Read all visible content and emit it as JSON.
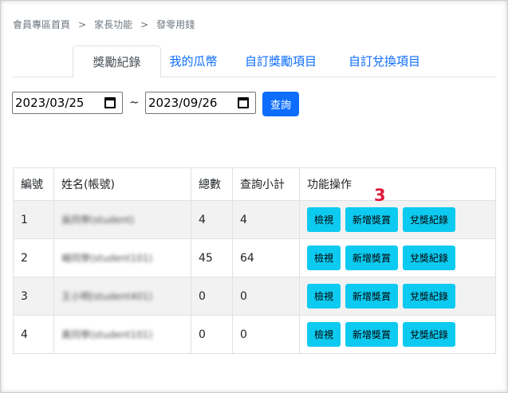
{
  "breadcrumb": [
    "會員專區首頁",
    "家長功能",
    "發零用錢"
  ],
  "breadcrumb_separator": ">",
  "tabs": [
    "獎勵紀錄",
    "我的瓜幣",
    "自訂獎勵項目",
    "自訂兌換項目"
  ],
  "filter": {
    "start_date": "2023/03/25",
    "end_date": "2023/09/26",
    "tilde": "~",
    "query_label": "查詢"
  },
  "table": {
    "headers": [
      "編號",
      "姓名(帳號)",
      "總數",
      "查詢小計",
      "功能操作"
    ],
    "rows": [
      {
        "no": "1",
        "name": "吳同學(student)",
        "total": "4",
        "subtotal": "4"
      },
      {
        "no": "2",
        "name": "楊同學(student101)",
        "total": "45",
        "subtotal": "64"
      },
      {
        "no": "3",
        "name": "王小明(student401)",
        "total": "0",
        "subtotal": "0"
      },
      {
        "no": "4",
        "name": "黃同學(student101)",
        "total": "0",
        "subtotal": "0"
      }
    ],
    "actions": {
      "view": "檢視",
      "add_reward": "新增獎賞",
      "redeem_record": "兌獎紀錄"
    }
  },
  "annotation": "3"
}
